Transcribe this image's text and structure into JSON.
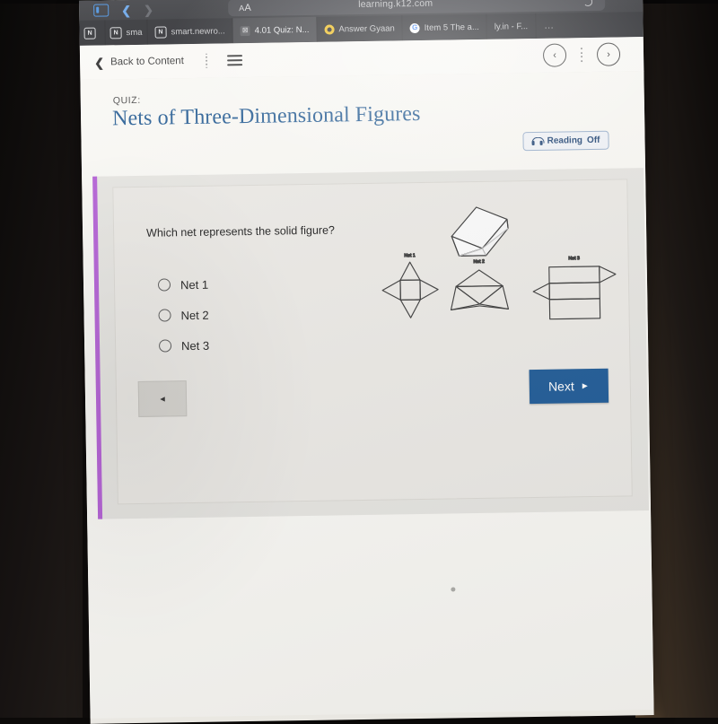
{
  "browser": {
    "url": "learning.k12.com",
    "reader_label": "AA",
    "sidebar_icon": "sidebar-icon",
    "back_icon": "chevron-left-icon",
    "forward_icon": "chevron-right-icon",
    "overflow_label": "…",
    "tabs": [
      {
        "title": "",
        "favicon": "newrow-icon",
        "active": false
      },
      {
        "title": "sma",
        "favicon": "newrow-icon",
        "active": false
      },
      {
        "title": "smart.newro...",
        "favicon": "newrow-icon",
        "active": false
      },
      {
        "title": "4.01 Quiz: N...",
        "favicon": "broken-image-icon",
        "active": true
      },
      {
        "title": "Answer Gyaan",
        "favicon": "yellow-dot-icon",
        "active": false
      },
      {
        "title": "Item 5 The a...",
        "favicon": "google-icon",
        "active": false
      },
      {
        "title": "ly.in - F...",
        "favicon": "none",
        "active": false
      }
    ]
  },
  "topnav": {
    "back_label": "Back to Content",
    "back_icon": "chevron-left-icon",
    "kebab_icon": "more-vertical-icon",
    "menu_icon": "hamburger-menu-icon",
    "prev_icon": "circle-chevron-left-icon",
    "next_icon": "circle-chevron-right-icon",
    "dots_icon": "more-vertical-icon",
    "prev_glyph": "‹",
    "next_glyph": "›"
  },
  "header": {
    "kicker": "QUIZ:",
    "title": "Nets of Three-Dimensional Figures",
    "reading": {
      "icon": "headphones-icon",
      "label": "Reading",
      "state": "Off"
    }
  },
  "question": {
    "text": "Which net represents the solid figure?",
    "options": [
      {
        "label": "Net 1",
        "selected": false
      },
      {
        "label": "Net 2",
        "selected": false
      },
      {
        "label": "Net 3",
        "selected": false
      }
    ]
  },
  "figure": {
    "solid_label": "",
    "solid_shape": "triangular-prism",
    "nets": [
      {
        "label": "Net 1",
        "shape": "square-pyramid-net"
      },
      {
        "label": "Net 2",
        "shape": "folded-triangles-net"
      },
      {
        "label": "Net 3",
        "shape": "triangular-prism-net"
      }
    ]
  },
  "footer": {
    "prev_label": "◄",
    "next_label": "Next",
    "next_glyph": "►"
  },
  "colors": {
    "accent_blue": "#1f5b97",
    "title_blue": "#2a6096",
    "panel_bar_purple": "#b45fd6",
    "card_bg": "#eceae6"
  }
}
